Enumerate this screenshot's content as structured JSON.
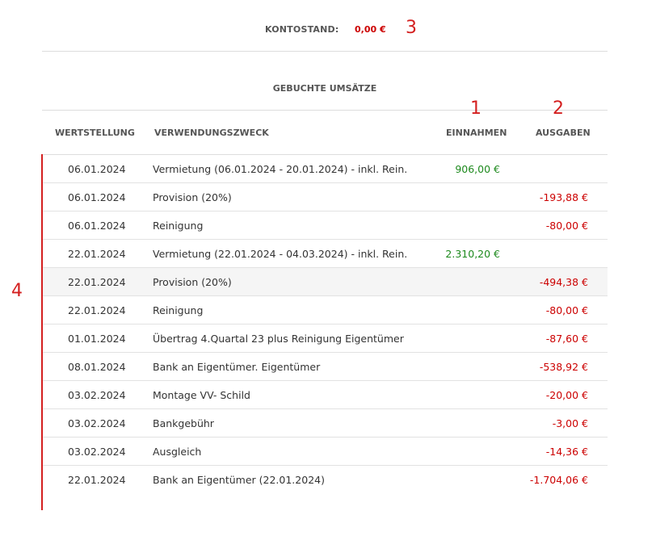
{
  "balance": {
    "label": "KONTOSTAND:",
    "value": "0,00 €"
  },
  "markers": {
    "m1": "1",
    "m2": "2",
    "m3": "3",
    "m4": "4"
  },
  "section_title": "GEBUCHTE UMSÄTZE",
  "columns": {
    "date": "WERTSTELLUNG",
    "purpose": "VERWENDUNGSZWECK",
    "income": "EINNAHMEN",
    "expense": "AUSGABEN"
  },
  "rows": [
    {
      "date": "06.01.2024",
      "purpose": "Vermietung (06.01.2024 - 20.01.2024) - inkl. Rein.",
      "income": "906,00 €",
      "expense": ""
    },
    {
      "date": "06.01.2024",
      "purpose": "Provision (20%)",
      "income": "",
      "expense": "-193,88 €"
    },
    {
      "date": "06.01.2024",
      "purpose": "Reinigung",
      "income": "",
      "expense": "-80,00 €"
    },
    {
      "date": "22.01.2024",
      "purpose": "Vermietung (22.01.2024 - 04.03.2024) - inkl. Rein.",
      "income": "2.310,20 €",
      "expense": ""
    },
    {
      "date": "22.01.2024",
      "purpose": "Provision (20%)",
      "income": "",
      "expense": "-494,38 €"
    },
    {
      "date": "22.01.2024",
      "purpose": "Reinigung",
      "income": "",
      "expense": "-80,00 €"
    },
    {
      "date": "01.01.2024",
      "purpose": "Übertrag 4.Quartal 23 plus Reinigung Eigentümer",
      "income": "",
      "expense": "-87,60 €"
    },
    {
      "date": "08.01.2024",
      "purpose": "Bank an Eigentümer. Eigentümer",
      "income": "",
      "expense": "-538,92 €"
    },
    {
      "date": "03.02.2024",
      "purpose": "Montage VV- Schild",
      "income": "",
      "expense": "-20,00 €"
    },
    {
      "date": "03.02.2024",
      "purpose": "Bankgebühr",
      "income": "",
      "expense": "-3,00 €"
    },
    {
      "date": "03.02.2024",
      "purpose": "Ausgleich",
      "income": "",
      "expense": "-14,36 €"
    },
    {
      "date": "22.01.2024",
      "purpose": "Bank an Eigentümer (22.01.2024)",
      "income": "",
      "expense": "-1.704,06 €"
    }
  ],
  "colors": {
    "income": "#1e8a1e",
    "expense": "#cc0000",
    "marker": "#d42020"
  }
}
